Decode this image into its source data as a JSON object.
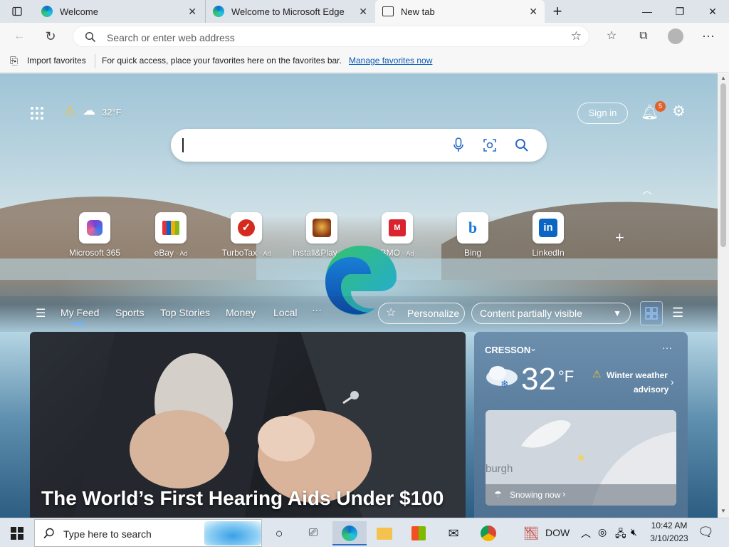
{
  "tabs": [
    {
      "title": "Welcome",
      "close": "✕"
    },
    {
      "title": "Welcome to Microsoft Edge",
      "close": "✕"
    },
    {
      "title": "New tab",
      "close": "✕"
    }
  ],
  "window_controls": {
    "new_tab": "+",
    "minimize": "—",
    "restore": "❐",
    "close": "✕"
  },
  "address_bar": {
    "placeholder": "Search or enter web address"
  },
  "favorites_bar": {
    "import_label": "Import favorites",
    "message": "For quick access, place your favorites here on the favorites bar.",
    "manage_link": "Manage favorites now"
  },
  "newtab": {
    "weather_temp": "32°F",
    "sign_in": "Sign in",
    "notification_count": "5",
    "quick_links": [
      {
        "label": "Microsoft 365",
        "ad": ""
      },
      {
        "label": "eBay",
        "ad": "· Ad"
      },
      {
        "label": "TurboTax",
        "ad": "· Ad"
      },
      {
        "label": "Install&Play",
        "ad": "· Ad"
      },
      {
        "label": "BMO",
        "ad": "· Ad"
      },
      {
        "label": "Bing",
        "ad": ""
      },
      {
        "label": "LinkedIn",
        "ad": ""
      }
    ],
    "add_tile": "+",
    "feed_tabs": [
      "My Feed",
      "Sports",
      "Top Stories",
      "Money",
      "Local"
    ],
    "more": "···",
    "personalize": "Personalize",
    "content_visibility": "Content partially visible",
    "hero_title": "The World’s First Hearing Aids Under $100",
    "weather_card": {
      "location": "CRESSON",
      "temp": "32",
      "unit": "°F",
      "alert_line1": "Winter weather",
      "alert_line2": "advisory",
      "map_label": "burgh",
      "condition": "Snowing now",
      "more": "···"
    }
  },
  "taskbar": {
    "search_placeholder": "Type here to search",
    "stock": "DOW",
    "time": "10:42 AM",
    "date": "3/10/2023"
  },
  "colors": {
    "accent": "#0a5bb5",
    "taskbar": "#dfe6ee",
    "badge": "#e0622a"
  }
}
